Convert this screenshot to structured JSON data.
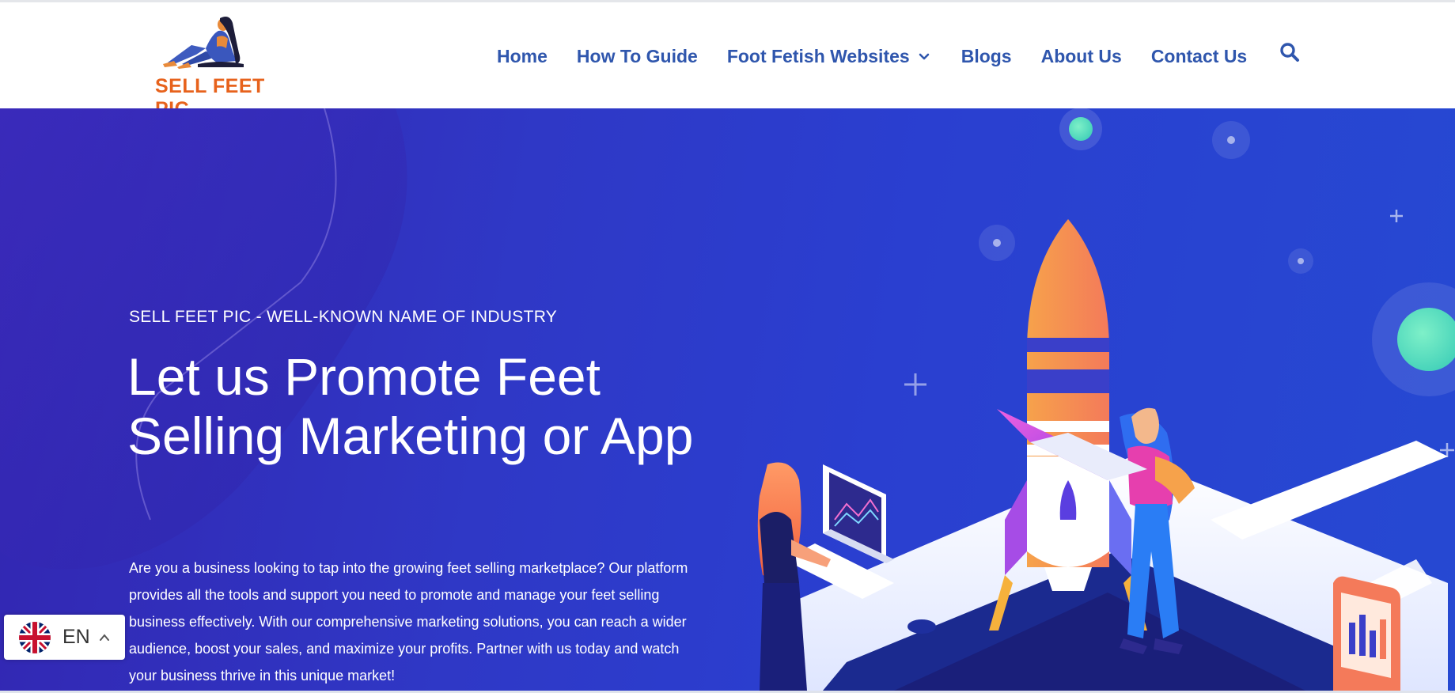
{
  "brand": {
    "logo_word1": "SELL FEET",
    "logo_word2": "PIC",
    "logo_icon": "seated-woman-logo-icon"
  },
  "nav": {
    "items": [
      {
        "label": "Home"
      },
      {
        "label": "How To Guide"
      },
      {
        "label": "Foot Fetish Websites",
        "has_dropdown": true
      },
      {
        "label": "Blogs"
      },
      {
        "label": "About Us"
      },
      {
        "label": "Contact Us"
      }
    ],
    "search_icon": "search-icon"
  },
  "hero": {
    "eyebrow": "SELL FEET PIC - WELL-KNOWN NAME OF INDUSTRY",
    "headline": "Let us Promote Feet Selling Marketing or App",
    "body": "Are you a business looking to tap into the growing feet selling marketplace? Our platform provides all the tools and support you need to promote and manage your feet selling business effectively. With our comprehensive marketing solutions, you can reach a wider audience, boost your sales, and maximize your profits. Partner with us today and watch your business thrive in this unique market!",
    "illustration": "rocket-launch-illustration"
  },
  "language": {
    "code": "EN",
    "flag_icon": "uk-flag-icon",
    "caret_icon": "caret-up-icon"
  },
  "colors": {
    "nav_text": "#2f56ad",
    "hero_bg": "#2f38c6",
    "logo_accent": "#e7621c",
    "hero_text": "#ffffff"
  }
}
